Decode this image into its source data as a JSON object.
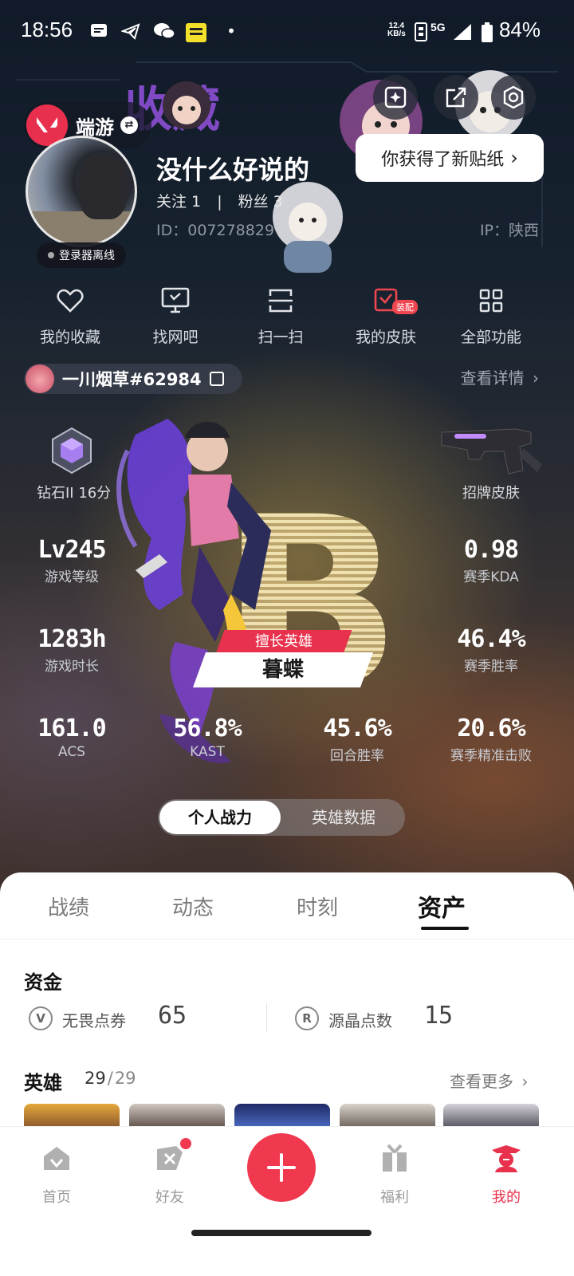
{
  "status_bar": {
    "time": "18:56",
    "net_speed": "12.4",
    "net_unit": "KB/s",
    "network": "5G",
    "battery": "84%"
  },
  "header": {
    "brand": "端游",
    "sticker_toast": "你获得了新贴纸",
    "login_status": "登录器离线",
    "nickname": "没什么好说的",
    "follow_text": "关注 1",
    "fans_text": "粉丝 3",
    "separator": "|",
    "user_id": "ID：007278829",
    "ip": "IP：陕西"
  },
  "quick_actions": [
    {
      "label": "我的收藏",
      "icon": "heart-icon"
    },
    {
      "label": "找网吧",
      "icon": "monitor-icon"
    },
    {
      "label": "扫一扫",
      "icon": "scan-icon"
    },
    {
      "label": "我的皮肤",
      "icon": "skin-icon",
      "badge": "装配"
    },
    {
      "label": "全部功能",
      "icon": "grid-icon"
    }
  ],
  "player": {
    "game_name": "一川烟草#62984",
    "details_link": "查看详情",
    "rank": "钻石II 16分",
    "skin": "招牌皮肤",
    "grade": "B",
    "hero_tag": "擅长英雄",
    "hero_name": "暮蝶"
  },
  "stats": {
    "level_value": "Lv245",
    "level_label": "游戏等级",
    "kda_value": "0.98",
    "kda_label": "赛季KDA",
    "time_value": "1283h",
    "time_label": "游戏时长",
    "winrate_value": "46.4%",
    "winrate_label": "赛季胜率",
    "acs_value": "161.0",
    "acs_label": "ACS",
    "kast_value": "56.8%",
    "kast_label": "KAST",
    "round_value": "45.6%",
    "round_label": "回合胜率",
    "precise_value": "20.6%",
    "precise_label": "赛季精准击败"
  },
  "segment": {
    "active": "个人战力",
    "inactive": "英雄数据"
  },
  "tabs": [
    "战绩",
    "动态",
    "时刻",
    "资产"
  ],
  "assets": {
    "funds_title": "资金",
    "vp_label": "无畏点券",
    "vp_value": "65",
    "rp_label": "源晶点数",
    "rp_value": "15",
    "heroes_title": "英雄",
    "heroes_owned": "29",
    "heroes_sep": "/",
    "heroes_total": "29",
    "see_more": "查看更多"
  },
  "bottom_nav": [
    {
      "label": "首页"
    },
    {
      "label": "好友"
    },
    {
      "label": "福利"
    },
    {
      "label": "我的"
    }
  ],
  "colors": {
    "accent": "#e8314c",
    "sheet_bg": "#ffffff"
  }
}
